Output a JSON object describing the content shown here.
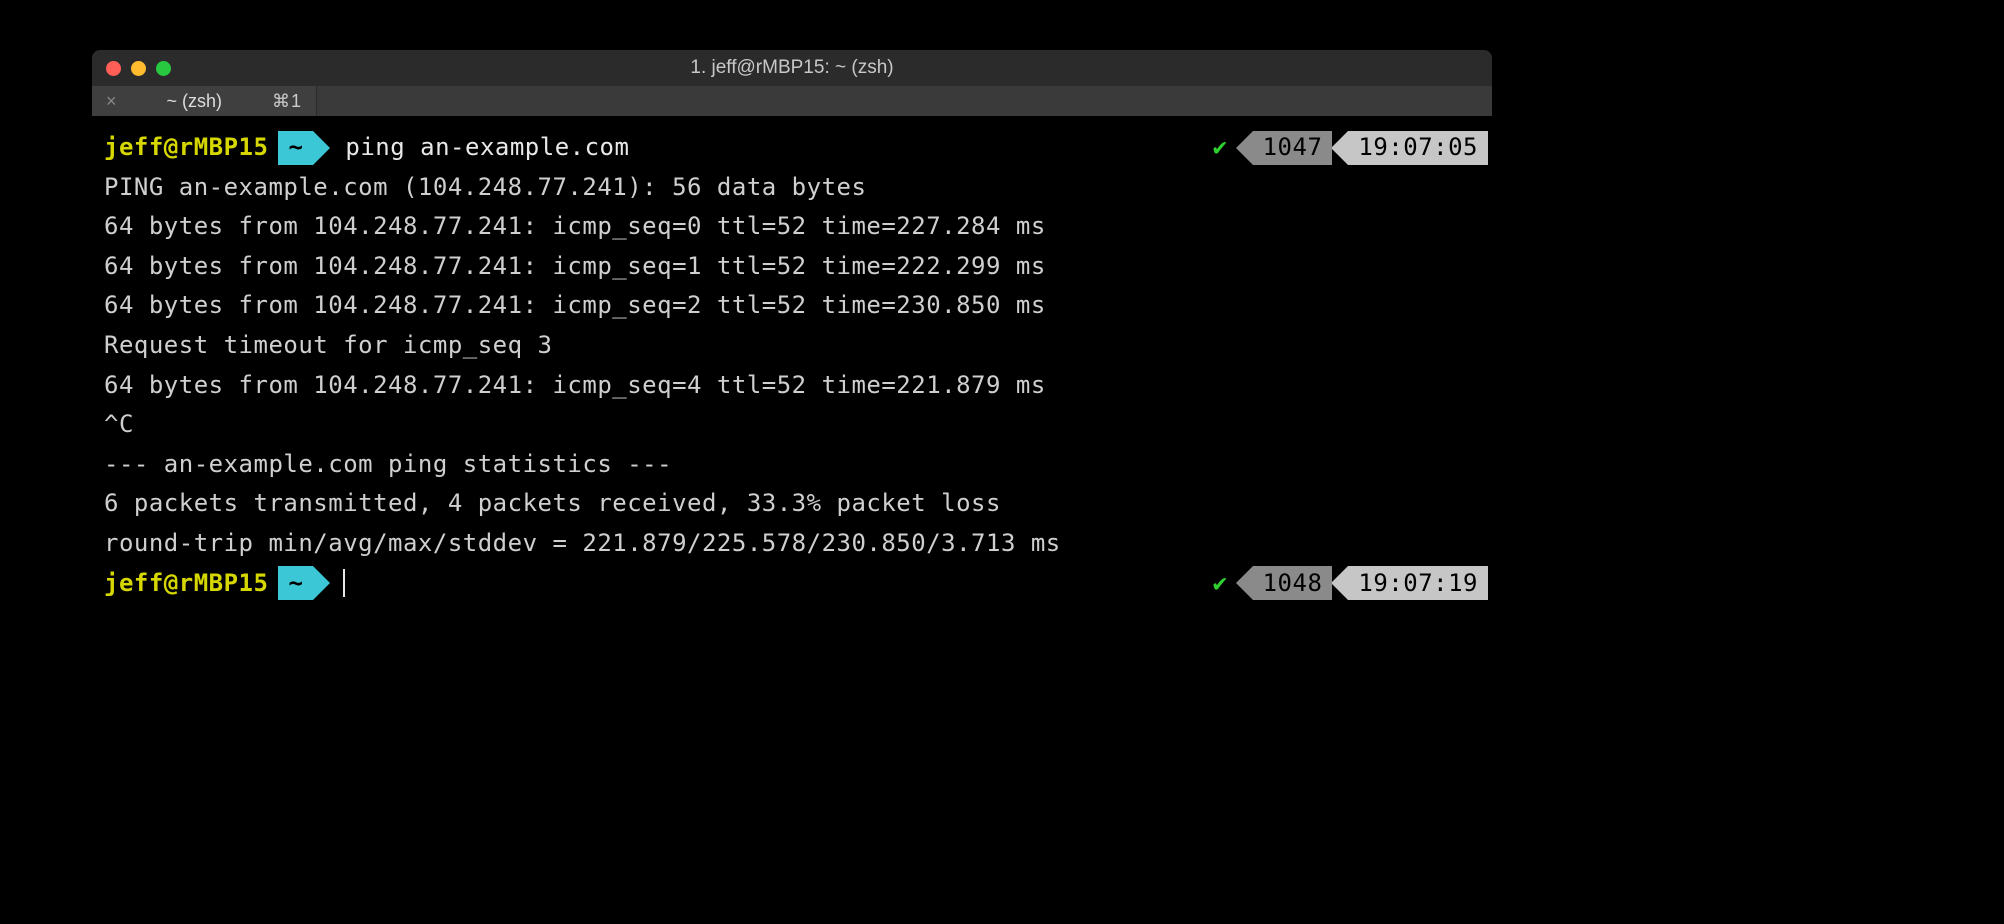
{
  "window": {
    "title": "1. jeff@rMBP15: ~ (zsh)"
  },
  "tab": {
    "close_glyph": "×",
    "title": "~ (zsh)",
    "shortcut": "⌘1"
  },
  "prompt1": {
    "user_host": "jeff@rMBP15",
    "dir": "~",
    "command": "ping an-example.com",
    "check": "✔",
    "history_num": "1047",
    "time": "19:07:05"
  },
  "output": [
    "PING an-example.com (104.248.77.241): 56 data bytes",
    "64 bytes from 104.248.77.241: icmp_seq=0 ttl=52 time=227.284 ms",
    "64 bytes from 104.248.77.241: icmp_seq=1 ttl=52 time=222.299 ms",
    "64 bytes from 104.248.77.241: icmp_seq=2 ttl=52 time=230.850 ms",
    "Request timeout for icmp_seq 3",
    "64 bytes from 104.248.77.241: icmp_seq=4 ttl=52 time=221.879 ms",
    "^C",
    "--- an-example.com ping statistics ---",
    "6 packets transmitted, 4 packets received, 33.3% packet loss",
    "round-trip min/avg/max/stddev = 221.879/225.578/230.850/3.713 ms"
  ],
  "prompt2": {
    "user_host": "jeff@rMBP15",
    "dir": "~",
    "check": "✔",
    "history_num": "1048",
    "time": "19:07:19"
  }
}
